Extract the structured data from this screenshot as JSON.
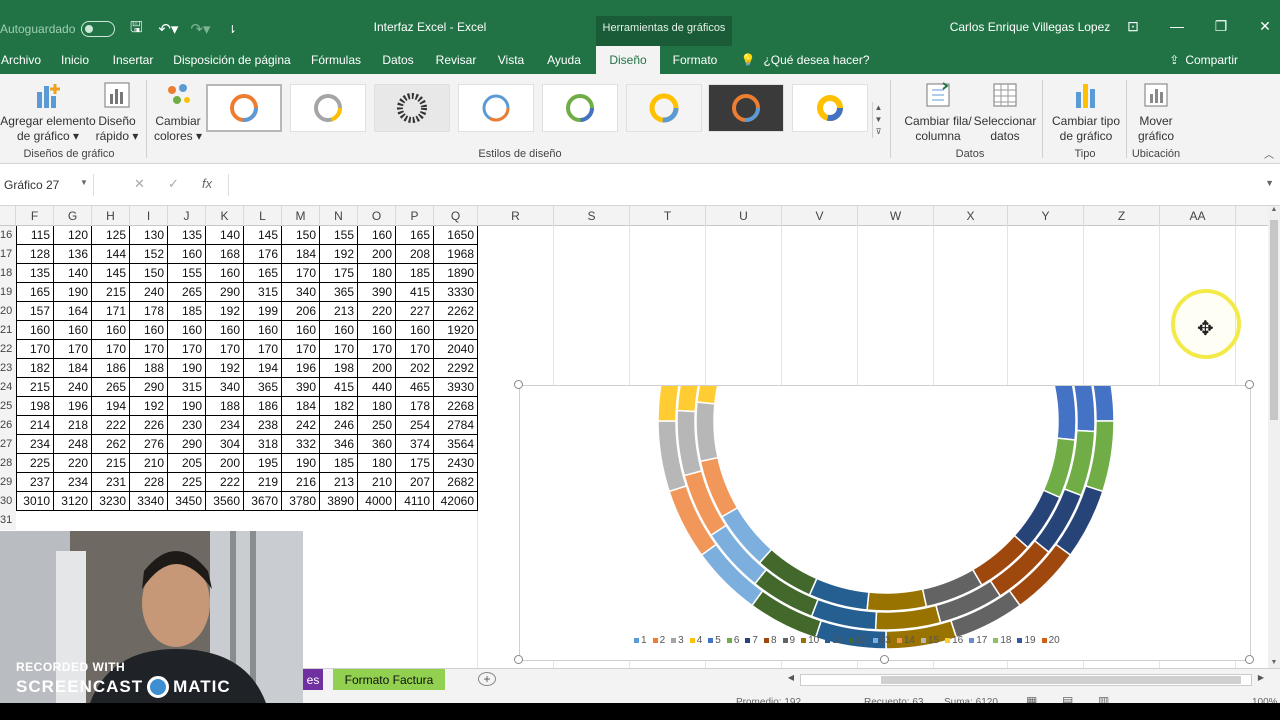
{
  "titlebar": {
    "autosave_label": "Autoguardado",
    "doc_title": "Interfaz Excel  -  Excel",
    "tools_header": "Herramientas de gráficos",
    "user_name": "Carlos Enrique Villegas Lopez"
  },
  "tabs": [
    "Archivo",
    "Inicio",
    "Insertar",
    "Disposición de página",
    "Fórmulas",
    "Datos",
    "Revisar",
    "Vista",
    "Ayuda",
    "Diseño",
    "Formato"
  ],
  "active_tab": "Diseño",
  "tell_me": "¿Qué desea hacer?",
  "share": "Compartir",
  "ribbon": {
    "add_element": [
      "Agregar elemento",
      "de gráfico ▾"
    ],
    "quick_layout": [
      "Diseño",
      "rápido ▾"
    ],
    "change_colors": [
      "Cambiar",
      "colores ▾"
    ],
    "switch_row_col": [
      "Cambiar fila/",
      "columna"
    ],
    "select_data": [
      "Seleccionar",
      "datos"
    ],
    "change_type": [
      "Cambiar tipo",
      "de gráfico"
    ],
    "move_chart": [
      "Mover",
      "gráfico"
    ],
    "groups": {
      "layouts": "Diseños de gráfico",
      "styles": "Estilos de diseño",
      "data": "Datos",
      "type": "Tipo",
      "location": "Ubicación"
    }
  },
  "formula_bar": {
    "name_box": "Gráfico 27",
    "fx": "fx",
    "value": ""
  },
  "columns": [
    "F",
    "G",
    "H",
    "I",
    "J",
    "K",
    "L",
    "M",
    "N",
    "O",
    "P",
    "Q",
    "R",
    "S",
    "T",
    "U",
    "V",
    "W",
    "X",
    "Y",
    "Z",
    "AA"
  ],
  "rows": [
    {
      "num": "16",
      "cells": [
        "115",
        "120",
        "125",
        "130",
        "135",
        "140",
        "145",
        "150",
        "155",
        "160",
        "165",
        "1650"
      ]
    },
    {
      "num": "17",
      "cells": [
        "128",
        "136",
        "144",
        "152",
        "160",
        "168",
        "176",
        "184",
        "192",
        "200",
        "208",
        "1968"
      ]
    },
    {
      "num": "18",
      "cells": [
        "135",
        "140",
        "145",
        "150",
        "155",
        "160",
        "165",
        "170",
        "175",
        "180",
        "185",
        "1890"
      ]
    },
    {
      "num": "19",
      "cells": [
        "165",
        "190",
        "215",
        "240",
        "265",
        "290",
        "315",
        "340",
        "365",
        "390",
        "415",
        "3330"
      ]
    },
    {
      "num": "20",
      "cells": [
        "157",
        "164",
        "171",
        "178",
        "185",
        "192",
        "199",
        "206",
        "213",
        "220",
        "227",
        "2262"
      ]
    },
    {
      "num": "21",
      "cells": [
        "160",
        "160",
        "160",
        "160",
        "160",
        "160",
        "160",
        "160",
        "160",
        "160",
        "160",
        "1920"
      ]
    },
    {
      "num": "22",
      "cells": [
        "170",
        "170",
        "170",
        "170",
        "170",
        "170",
        "170",
        "170",
        "170",
        "170",
        "170",
        "2040"
      ]
    },
    {
      "num": "23",
      "cells": [
        "182",
        "184",
        "186",
        "188",
        "190",
        "192",
        "194",
        "196",
        "198",
        "200",
        "202",
        "2292"
      ]
    },
    {
      "num": "24",
      "cells": [
        "215",
        "240",
        "265",
        "290",
        "315",
        "340",
        "365",
        "390",
        "415",
        "440",
        "465",
        "3930"
      ]
    },
    {
      "num": "25",
      "cells": [
        "198",
        "196",
        "194",
        "192",
        "190",
        "188",
        "186",
        "184",
        "182",
        "180",
        "178",
        "2268"
      ]
    },
    {
      "num": "26",
      "cells": [
        "214",
        "218",
        "222",
        "226",
        "230",
        "234",
        "238",
        "242",
        "246",
        "250",
        "254",
        "2784"
      ]
    },
    {
      "num": "27",
      "cells": [
        "234",
        "248",
        "262",
        "276",
        "290",
        "304",
        "318",
        "332",
        "346",
        "360",
        "374",
        "3564"
      ]
    },
    {
      "num": "28",
      "cells": [
        "225",
        "220",
        "215",
        "210",
        "205",
        "200",
        "195",
        "190",
        "185",
        "180",
        "175",
        "2430"
      ]
    },
    {
      "num": "29",
      "cells": [
        "237",
        "234",
        "231",
        "228",
        "225",
        "222",
        "219",
        "216",
        "213",
        "210",
        "207",
        "2682"
      ]
    },
    {
      "num": "30",
      "cells": [
        "3010",
        "3120",
        "3230",
        "3340",
        "3450",
        "3560",
        "3670",
        "3780",
        "3890",
        "4000",
        "4110",
        "42060"
      ]
    },
    {
      "num": "31",
      "cells": []
    }
  ],
  "chart_data": {
    "type": "doughnut",
    "legend": [
      "1",
      "2",
      "3",
      "4",
      "5",
      "6",
      "7",
      "8",
      "9",
      "10",
      "11",
      "12",
      "13",
      "14",
      "15",
      "16",
      "17",
      "18",
      "19",
      "20"
    ],
    "legend_position": "bottom",
    "colors": [
      "#5b9bd5",
      "#ed7d31",
      "#a5a5a5",
      "#ffc000",
      "#4472c4",
      "#70ad47",
      "#264478",
      "#9e480e",
      "#636363",
      "#997300",
      "#255e91",
      "#43682b",
      "#7cafdd",
      "#f1975a",
      "#b7b7b7",
      "#ffcd33",
      "#698ed0",
      "#8cc168",
      "#335aa1",
      "#d26012"
    ],
    "rings": 3,
    "series_rows": [
      "16",
      "17",
      "18"
    ]
  },
  "sheet_tabs": {
    "partial": "es",
    "factura": "Formato Factura",
    "add": "+"
  },
  "status": {
    "promedio": "Promedio: 192",
    "recuento": "Recuento: 63",
    "suma": "Suma: 6120",
    "zoom": "100%"
  },
  "overlay": {
    "recorded_with": "RECORDED WITH",
    "brand_a": "SCREENCAST",
    "brand_b": "MATIC"
  }
}
